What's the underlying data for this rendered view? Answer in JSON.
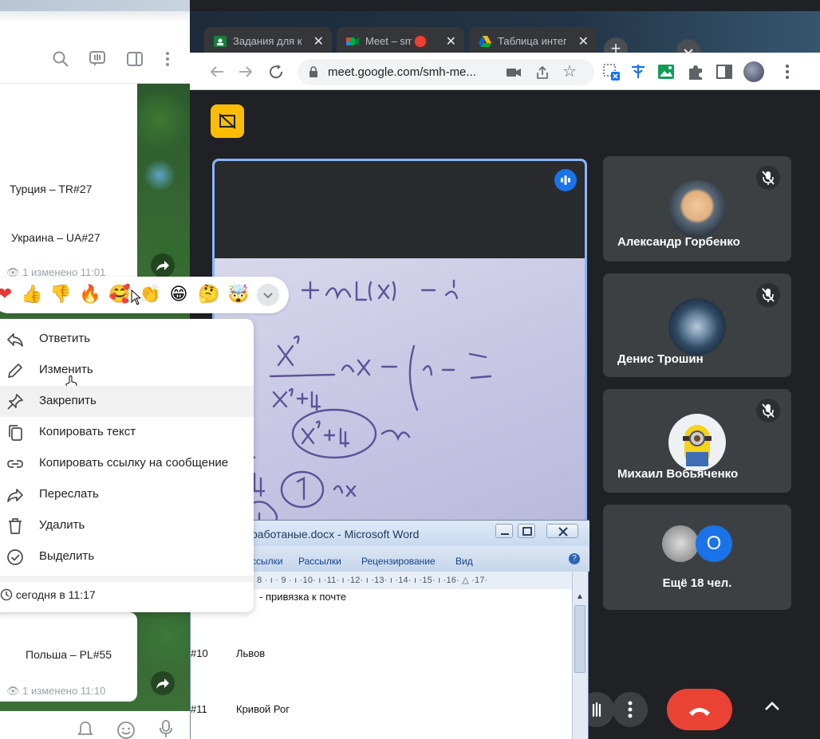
{
  "telegram": {
    "messages": [
      {
        "text": "Турция – TR#27"
      },
      {
        "text": "Украина – UA#27"
      },
      {
        "views": "1",
        "edited": "изменено 11:01"
      },
      {
        "text": "Польша – PL#55"
      },
      {
        "views": "1",
        "edited": "изменено 11:10"
      }
    ],
    "reactions": [
      "❤",
      "👍",
      "👎",
      "🔥",
      "🥰",
      "👏",
      "😁",
      "🤔",
      "🤯"
    ],
    "context_menu": {
      "items": [
        {
          "label": "Ответить",
          "icon": "reply-icon"
        },
        {
          "label": "Изменить",
          "icon": "pencil-icon"
        },
        {
          "label": "Закрепить",
          "icon": "pin-icon"
        },
        {
          "label": "Копировать текст",
          "icon": "copy-icon"
        },
        {
          "label": "Копировать ссылку на сообщение",
          "icon": "link-icon"
        },
        {
          "label": "Переслать",
          "icon": "forward-icon"
        },
        {
          "label": "Удалить",
          "icon": "trash-icon"
        },
        {
          "label": "Выделить",
          "icon": "check-circle-icon"
        }
      ],
      "timestamp": "сегодня в 11:17"
    }
  },
  "chrome": {
    "tabs": [
      {
        "title": "Задания для к",
        "favicon": "classroom-icon"
      },
      {
        "title": "Meet – sm",
        "favicon": "meet-icon"
      },
      {
        "title": "Таблица интег",
        "favicon": "drive-icon"
      }
    ],
    "url": "meet.google.com/smh-me..."
  },
  "meet": {
    "participants": [
      {
        "name": "Александр Горбенко"
      },
      {
        "name": "Денис Трошин"
      },
      {
        "name": "Михаил Вобьяченко"
      }
    ],
    "more_count_badge": "O",
    "more_label": "Ещё 18 чел."
  },
  "word": {
    "title": "работаные.docx - Microsoft Word",
    "ribbon_tabs": [
      "ссылки",
      "Рассылки",
      "Рецензирование",
      "Вид"
    ],
    "ruler": "· 8 · ı · 9 · ı ·10· ı ·11· ı ·12· ı ·13· ı ·14· ı ·15· ı ·16· △ ·17·",
    "lines": [
      {
        "num": "",
        "text": "- привязка к почте"
      },
      {
        "num": "#10",
        "text": "Львов"
      },
      {
        "num": "#11",
        "text": "Кривой Рог"
      }
    ]
  },
  "colors": {
    "meet_bg": "#202124",
    "tile_bg": "#3c4043",
    "hangup": "#ea4335",
    "accent_blue": "#1a73e8",
    "yellow": "#fbbc04"
  }
}
